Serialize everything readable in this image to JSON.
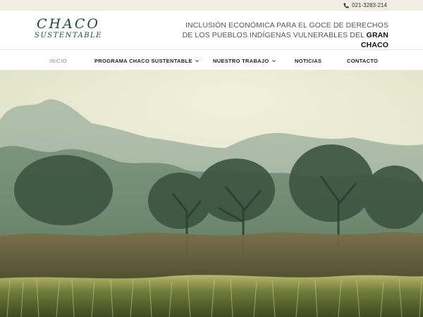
{
  "topbar": {
    "phone_icon": "phone-icon",
    "phone": "021-3283-214"
  },
  "header": {
    "logo_line1": "CHACO",
    "logo_line2": "SUSTENTABLE",
    "tagline_part1": "INCLUSIÓN ECONÓMICA PARA EL GOCE DE DERECHOS DE LOS PUEBLOS INDÍGENAS VULNERABLES DEL ",
    "tagline_bold": "GRAN CHACO"
  },
  "nav": {
    "items": [
      {
        "label": "INICIO",
        "active": true
      },
      {
        "label": "PROGRAMA CHACO SUSTENTABLE",
        "dropdown": true
      },
      {
        "label": "NUESTRO TRABAJO",
        "dropdown": true
      },
      {
        "label": "NOTICIAS"
      },
      {
        "label": "CONTACTO"
      }
    ]
  },
  "colors": {
    "topbar_bg": "#f1ede3",
    "logo_green": "#1f4a36",
    "hero_sky": "#e6ead0"
  }
}
